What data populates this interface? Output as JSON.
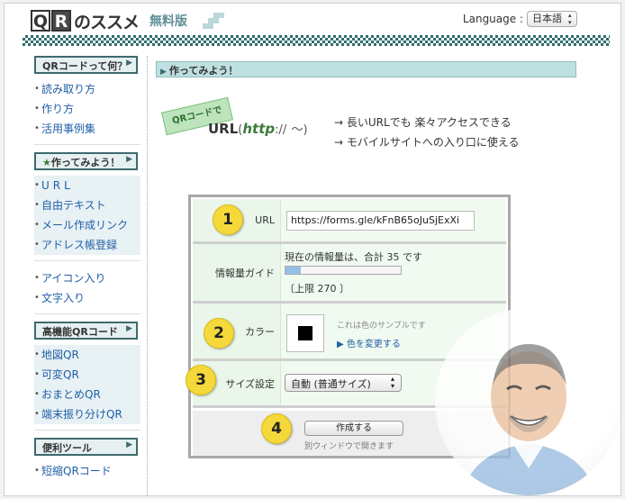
{
  "header": {
    "logo_box1": "Q",
    "logo_box2": "R",
    "logo_rest": "のススメ",
    "logo_free": "無料版",
    "language_label": "Language :",
    "language_value": "日本語"
  },
  "sidebar": {
    "sections": [
      {
        "title": "QRコードって何？",
        "items": [
          "読み取り方",
          "作り方",
          "活用事例集"
        ]
      },
      {
        "title": "作ってみよう！",
        "star": "★",
        "items": [
          "URL",
          "自由テキスト",
          "メール作成リンク",
          "アドレス帳登録"
        ]
      },
      {
        "title": "",
        "items": [
          "アイコン入り",
          "文字入り"
        ]
      },
      {
        "title": "高機能QRコード",
        "items": [
          "地図QR",
          "可変QR",
          "おまとめQR",
          "端末振り分けQR"
        ]
      },
      {
        "title": "便利ツール",
        "items": [
          "短縮QRコード"
        ]
      }
    ]
  },
  "main": {
    "section_title": "作ってみよう！",
    "badge": "QRコードで",
    "url_title": "URL",
    "url_paren_open": "(",
    "url_http": "http",
    "url_colon": "://",
    "url_tilde": "〜)",
    "benefits": [
      "→ 長いURLでも 楽々アクセスできる",
      "→ モバイルサイトへの入り口に使える"
    ]
  },
  "form": {
    "step1_number": "1",
    "url_label": "URL",
    "url_value": "https://forms.gle/kFnB65oJuSjExXi",
    "gauge_label": "情報量ガイド",
    "gauge_text": "現在の情報量は、合計 35 です",
    "gauge_limit": "〔上限 270 〕",
    "gauge_current": 35,
    "gauge_max": 270,
    "step2_number": "2",
    "color_label": "カラー",
    "color_value": "#000000",
    "color_sample_text": "これは色のサンプルです",
    "color_change_link": "▶ 色を変更する",
    "step3_number": "3",
    "size_label": "サイズ設定",
    "size_value": "自動 (普通サイズ)",
    "step4_number": "4",
    "create_button": "作成する",
    "create_note": "別ウィンドウで開きます"
  },
  "colors": {
    "accent": "#3e6a6e",
    "link": "#1f5fa5",
    "step_badge": "#f5d93a"
  }
}
